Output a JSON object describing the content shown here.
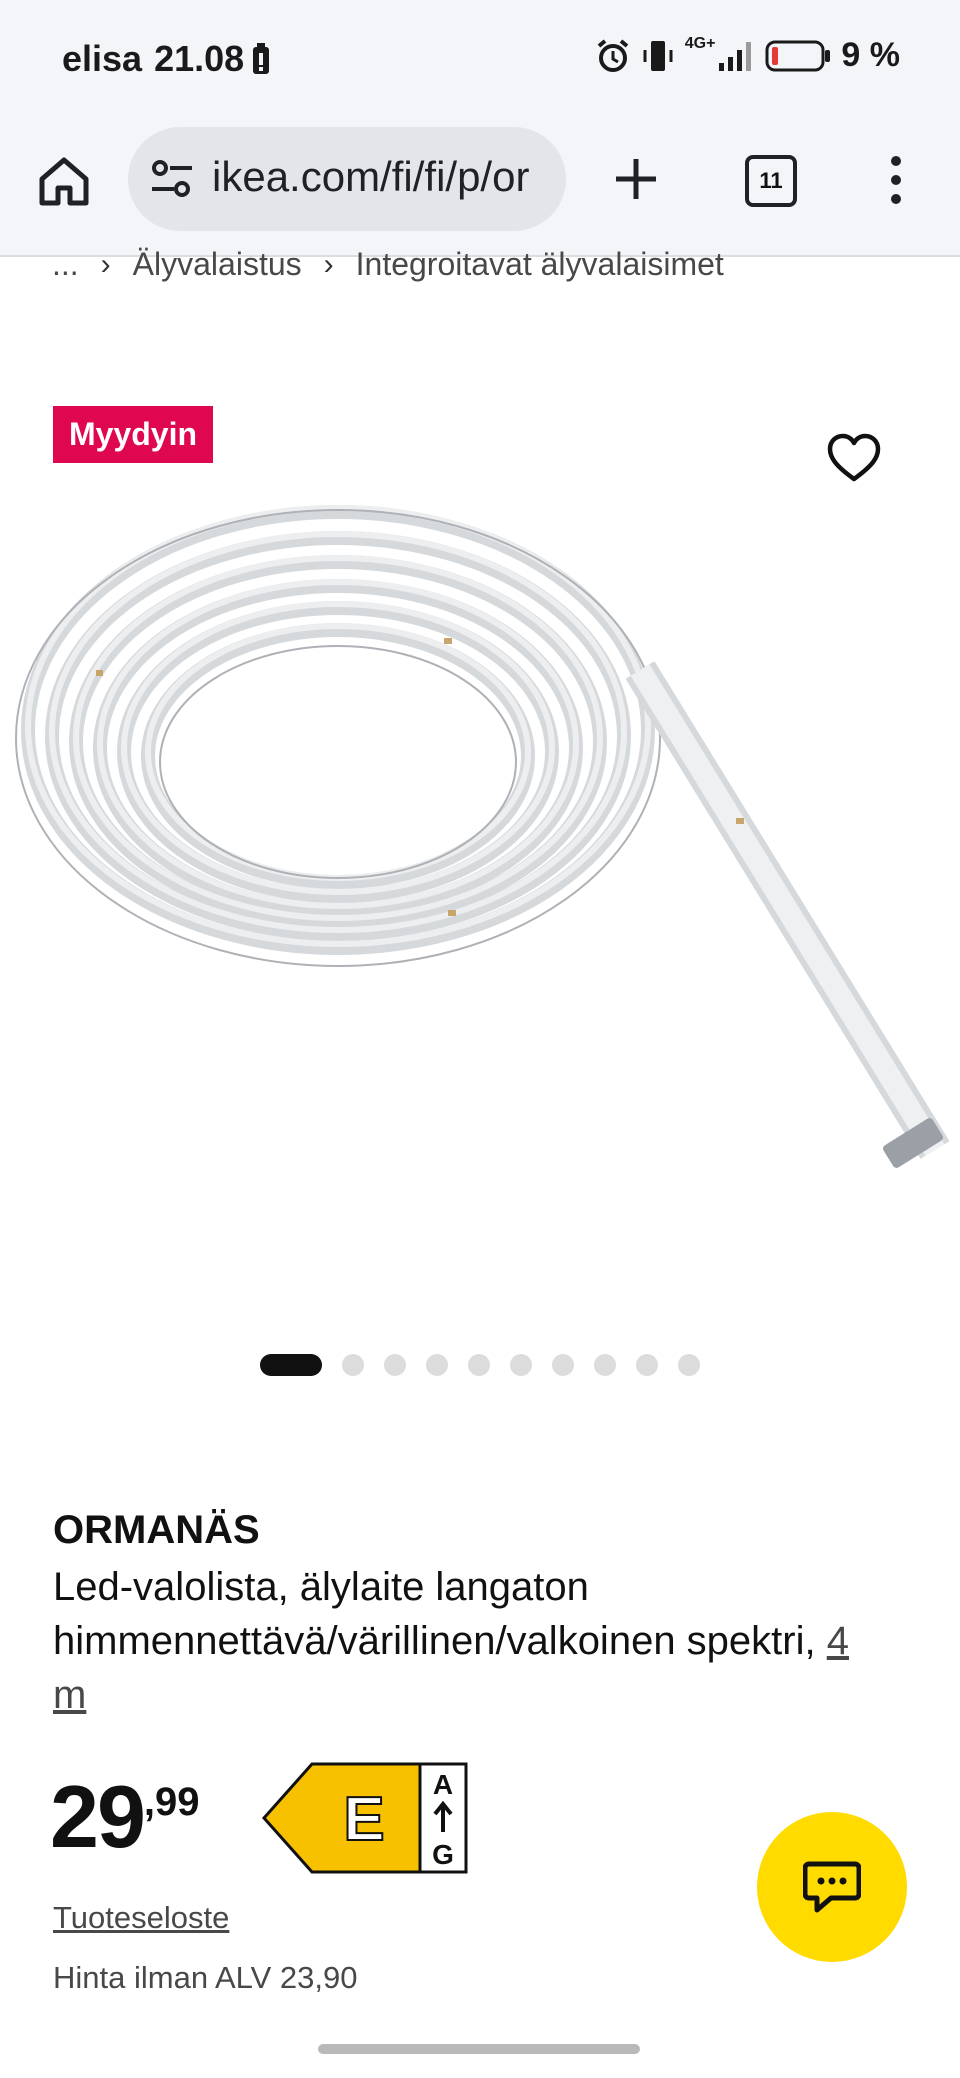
{
  "status_bar": {
    "carrier": "elisa",
    "time": "21.08",
    "network": "4G+",
    "battery_percent": "9 %"
  },
  "browser": {
    "url": "ikea.com/fi/fi/p/or",
    "tab_count": "11"
  },
  "breadcrumb": {
    "ellipsis": "...",
    "items": [
      "Älyvalaistus",
      "Integroitavat älyvalaisimet"
    ]
  },
  "badge": "Myydyin",
  "carousel": {
    "total": 10,
    "active": 1
  },
  "product": {
    "name": "ORMANÄS",
    "description": "Led-valolista, älylaite langaton himmennettävä/värillinen/valkoinen spektri,",
    "size_link": "4 m",
    "price_int": "29",
    "price_dec": ",99",
    "energy_class": "E",
    "energy_top": "A",
    "energy_bottom": "G",
    "datasheet_link": "Tuoteseloste",
    "vat_note": "Hinta ilman ALV 23,90"
  },
  "colors": {
    "badge_bg": "#e00751",
    "fab_bg": "#ffdb00",
    "energy_e": "#f8c100"
  },
  "icons": [
    "home-icon",
    "tune-icon",
    "plus-icon",
    "tabs-icon",
    "more-vert-icon",
    "heart-icon",
    "chat-icon"
  ]
}
